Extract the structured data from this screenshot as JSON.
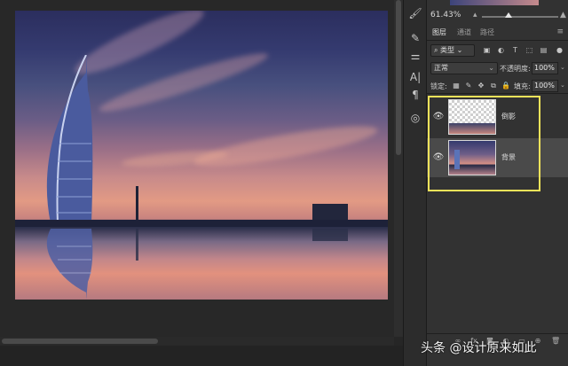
{
  "zoom": {
    "value": "61.43%"
  },
  "layers_panel": {
    "tabs": [
      {
        "label": "图层",
        "active": true
      },
      {
        "label": "通道",
        "active": false
      },
      {
        "label": "路径",
        "active": false
      }
    ],
    "filter": {
      "label": "类型"
    },
    "blend_mode": "正常",
    "opacity_label": "不透明度:",
    "opacity_value": "100%",
    "lock_label": "锁定:",
    "fill_label": "填充:",
    "fill_value": "100%",
    "layers": [
      {
        "name": "倒影",
        "visible": true,
        "selected": false,
        "thumb": "transparent-with-reflection"
      },
      {
        "name": "背景",
        "visible": true,
        "selected": true,
        "thumb": "photo"
      }
    ]
  },
  "highlight_color": "#f2e35a",
  "watermark": "头条 @设计原来如此",
  "icons": {
    "tools": [
      "brush-icon",
      "sliders-icon",
      "text-icon",
      "paragraph-icon",
      "adjust-icon"
    ],
    "eye": "eye-icon"
  }
}
